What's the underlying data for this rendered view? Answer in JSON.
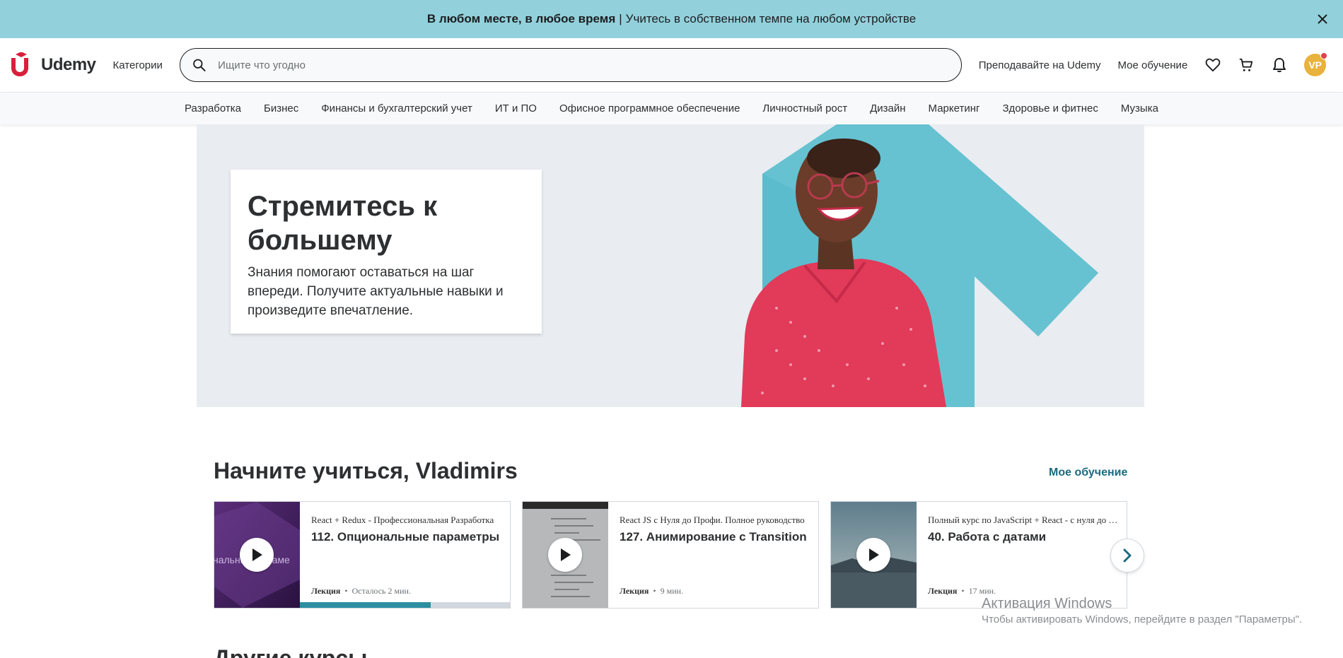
{
  "promo": {
    "bold_text": "В любом месте, в любое время",
    "separator": "|",
    "text": "Учитесь в собственном темпе на любом устройстве"
  },
  "header": {
    "logo_text": "Udemy",
    "categories_label": "Категории",
    "search_placeholder": "Ищите что угодно",
    "teach_link": "Преподавайте на Udemy",
    "my_learning_link": "Мое обучение",
    "avatar_initials": "VP"
  },
  "catnav": {
    "items": [
      "Разработка",
      "Бизнес",
      "Финансы и бухгалтерский учет",
      "ИТ и ПО",
      "Офисное программное обеспечение",
      "Личностный рост",
      "Дизайн",
      "Маркетинг",
      "Здоровье и фитнес",
      "Музыка"
    ]
  },
  "hero": {
    "title": "Стремитесь к большему",
    "subtitle": "Знания помогают оставаться на шаг впереди. Получите актуальные навыки и произведите впечатление."
  },
  "section": {
    "title": "Начните учиться, Vladimirs",
    "link": "Мое обучение"
  },
  "cards": [
    {
      "course": "React + Redux - Профессиональная Разработка",
      "lecture": "112. Опциональные параметры",
      "meta_type": "Лекция",
      "meta_info": "Осталось 2 мин.",
      "progress": 0.62,
      "thumb_text": "нальные параме"
    },
    {
      "course": "React JS с Нуля до Профи. Полное руководство",
      "lecture": "127. Анимирование с Transition",
      "meta_type": "Лекция",
      "meta_info": "9 мин.",
      "progress": 0
    },
    {
      "course": "Полный курс по JavaScript + React - с нуля до результата",
      "lecture": "40. Работа с датами",
      "meta_type": "Лекция",
      "meta_info": "17 мин.",
      "progress": 0
    }
  ],
  "next_section_title": "Другие курсы",
  "watermark": {
    "title": "Активация Windows",
    "text": "Чтобы активировать Windows, перейдите в раздел \"Параметры\"."
  },
  "colors": {
    "promo_bg": "#92d1dc",
    "accent_link": "#1b6a80",
    "progress": "#2d8ea0",
    "logo": "#a435f0"
  }
}
